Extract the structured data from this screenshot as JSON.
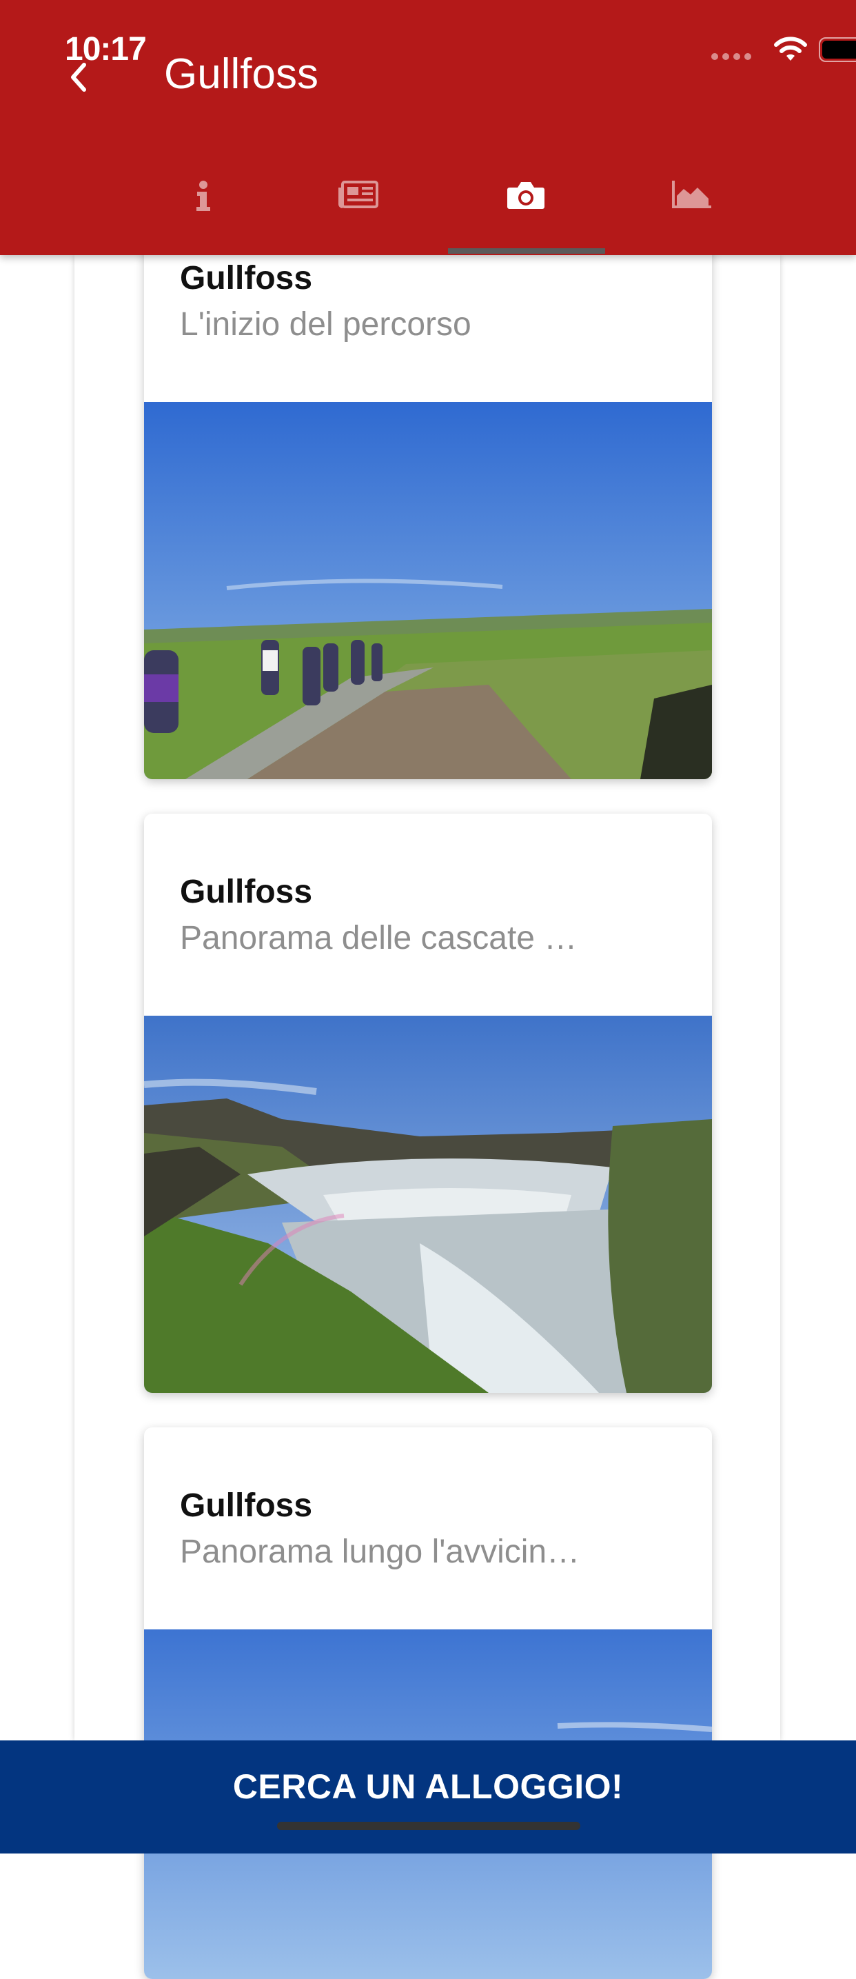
{
  "status_bar": {
    "time": "10:17"
  },
  "header": {
    "title": "Gullfoss",
    "back_icon": "chevron-left-icon"
  },
  "tabs": [
    {
      "icon": "info-icon",
      "active": false
    },
    {
      "icon": "newspaper-icon",
      "active": false
    },
    {
      "icon": "camera-icon",
      "active": true
    },
    {
      "icon": "elevation-chart-icon",
      "active": false
    }
  ],
  "cards": [
    {
      "title": "Gullfoss",
      "subtitle": "L'inizio del percorso"
    },
    {
      "title": "Gullfoss",
      "subtitle": "Panorama delle cascate …"
    },
    {
      "title": "Gullfoss",
      "subtitle": "Panorama lungo l'avvicin…"
    }
  ],
  "bottom_bar": {
    "label": "CERCA UN ALLOGGIO!"
  },
  "colors": {
    "header": "#b41919",
    "bottom_bar": "#033580",
    "subtitle": "#8e8e8e"
  }
}
